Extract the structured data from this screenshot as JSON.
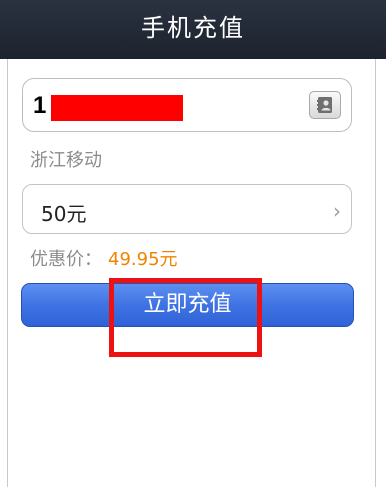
{
  "header": {
    "title": "手机充值"
  },
  "phone_field": {
    "value_prefix": "1",
    "icon": "contacts-icon"
  },
  "carrier": {
    "text": "浙江移动"
  },
  "amount": {
    "selected": "50元",
    "icon": "chevron-right-icon"
  },
  "discount": {
    "label": "优惠价：",
    "value": "49.95元"
  },
  "submit": {
    "label": "立即充值"
  },
  "colors": {
    "header_bg": "#1d232e",
    "button_blue": "#3f73e3",
    "price_orange": "#f08300",
    "redaction_red": "#ff0000",
    "highlight_red": "#ee1111"
  }
}
